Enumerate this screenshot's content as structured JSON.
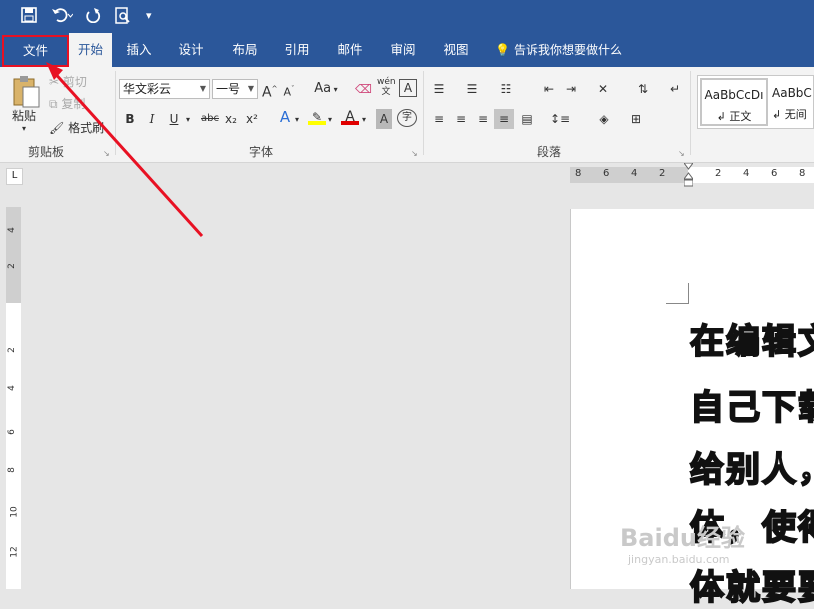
{
  "qat": {
    "save_icon": "save-icon",
    "undo_icon": "undo-icon",
    "redo_icon": "redo-icon",
    "preview_icon": "print-preview-icon",
    "customize_icon": "customize-qat-icon"
  },
  "tabs": {
    "file": "文件",
    "home": "开始",
    "insert": "插入",
    "design": "设计",
    "layout": "布局",
    "references": "引用",
    "mailings": "邮件",
    "review": "审阅",
    "view": "视图",
    "tell_me": "告诉我你想要做什么"
  },
  "clipboard": {
    "paste": "粘贴",
    "cut": "剪切",
    "copy": "复制",
    "format_painter": "格式刷",
    "group_label": "剪贴板"
  },
  "font": {
    "font_name": "华文彩云",
    "font_size": "一号",
    "group_label": "字体",
    "bold": "B",
    "italic": "I",
    "underline": "U",
    "strike": "abc",
    "subscript": "x₂",
    "superscript": "x²",
    "change_case": "Aa",
    "grow": "A",
    "shrink": "A",
    "phonetic": "wén",
    "enclose": "字",
    "border_char": "A"
  },
  "paragraph": {
    "group_label": "段落"
  },
  "styles": {
    "normal_preview": "AaBbCcDı",
    "normal_label": "↲ 正文",
    "nospacing_preview": "AaBbC",
    "nospacing_label": "↲ 无间"
  },
  "ruler": {
    "h_numbers": [
      "8",
      "6",
      "4",
      "2",
      "2",
      "4",
      "6",
      "8"
    ],
    "v_numbers": [
      "4",
      "2",
      "2",
      "4",
      "6",
      "8",
      "10",
      "12"
    ],
    "corner": "L"
  },
  "document": {
    "lines": [
      "在编辑文",
      "自己下载",
      "给别人，",
      "体，使得",
      "体就要要"
    ]
  },
  "watermark": {
    "text": "Baidu经验",
    "url": "jingyan.baidu.com"
  },
  "colors": {
    "accent": "#2b579a",
    "annotation": "#e81123"
  }
}
